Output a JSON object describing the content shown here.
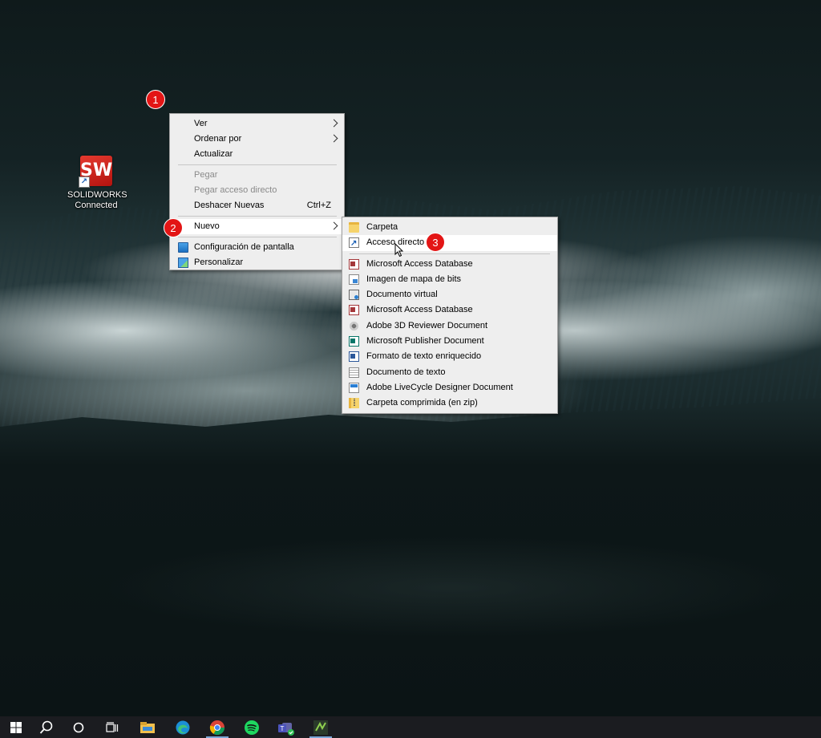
{
  "desktop": {
    "icons": [
      {
        "label_line1": "SOLIDWORKS",
        "label_line2": "Connected",
        "logo_text": "SW",
        "icon": "solidworks-icon"
      }
    ]
  },
  "context_menu": {
    "items": [
      {
        "label": "Ver",
        "has_submenu": true
      },
      {
        "label": "Ordenar por",
        "has_submenu": true
      },
      {
        "label": "Actualizar"
      },
      {
        "label": "Pegar",
        "disabled": true
      },
      {
        "label": "Pegar acceso directo",
        "disabled": true
      },
      {
        "label": "Deshacer Nuevas",
        "shortcut": "Ctrl+Z"
      },
      {
        "label": "Nuevo",
        "has_submenu": true,
        "highlighted": true
      },
      {
        "label": "Configuración de pantalla",
        "icon": "display-settings-icon"
      },
      {
        "label": "Personalizar",
        "icon": "personalize-icon"
      }
    ]
  },
  "new_submenu": {
    "items": [
      {
        "label": "Carpeta",
        "icon": "folder-icon"
      },
      {
        "label": "Acceso directo",
        "icon": "shortcut-icon",
        "highlighted": true
      },
      {
        "label": "Microsoft Access Database",
        "icon": "access-icon"
      },
      {
        "label": "Imagen de mapa de bits",
        "icon": "bitmap-icon"
      },
      {
        "label": "Documento virtual",
        "icon": "virtual-disk-icon"
      },
      {
        "label": "Microsoft Access Database",
        "icon": "access-icon"
      },
      {
        "label": "Adobe 3D Reviewer Document",
        "icon": "3d-reviewer-icon"
      },
      {
        "label": "Microsoft Publisher Document",
        "icon": "publisher-icon"
      },
      {
        "label": "Formato de texto enriquecido",
        "icon": "rtf-icon"
      },
      {
        "label": "Documento de texto",
        "icon": "text-document-icon"
      },
      {
        "label": "Adobe LiveCycle Designer Document",
        "icon": "livecycle-icon"
      },
      {
        "label": "Carpeta comprimida (en zip)",
        "icon": "zip-folder-icon"
      }
    ]
  },
  "annotations": {
    "step1": "1",
    "step2": "2",
    "step3": "3"
  },
  "taskbar": {
    "items": [
      "windows-start-icon",
      "search-icon",
      "cortana-icon",
      "task-view-icon",
      "file-explorer-icon",
      "edge-icon",
      "chrome-icon",
      "spotify-icon",
      "teams-icon",
      "app-icon"
    ]
  },
  "colors": {
    "menu_background": "#eeeeee",
    "menu_highlight": "#ffffff",
    "badge": "#e31515",
    "taskbar": "#1b1c20"
  }
}
